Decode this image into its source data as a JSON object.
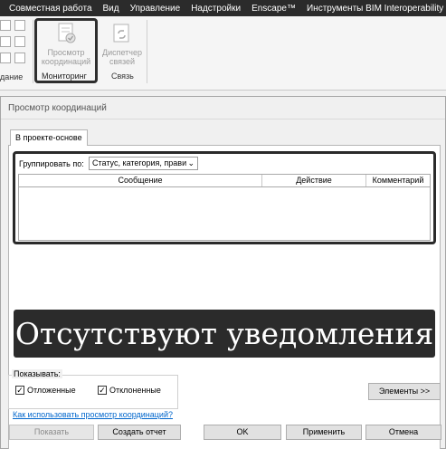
{
  "ribbon": {
    "menu": [
      "Совместная работа",
      "Вид",
      "Управление",
      "Надстройки",
      "Enscape™",
      "Инструменты BIM Interoperability"
    ],
    "left_panel_label": "дание",
    "buttons": {
      "coordination_review": [
        "Просмотр",
        "координаций"
      ],
      "link_manager": [
        "Диспетчер",
        "связей"
      ]
    },
    "panels": {
      "monitoring": "Мониторинг",
      "link": "Связь"
    }
  },
  "dialog": {
    "title": "Просмотр координаций",
    "tab": "В проекте-основе",
    "group_by_label": "Группировать по:",
    "group_by_value": "Статус, категория, прави",
    "columns": [
      "Сообщение",
      "Действие",
      "Комментарий"
    ],
    "banner": "Отсутствуют уведомления",
    "show_legend": "Показывать:",
    "checkboxes": [
      {
        "label": "Отложенные",
        "checked": true
      },
      {
        "label": "Отклоненные",
        "checked": true
      }
    ],
    "elements_button": "Элементы >>",
    "help_link": "Как использовать просмотр координаций?",
    "buttons": {
      "show": "Показать",
      "report": "Создать отчет",
      "ok": "OK",
      "apply": "Применить",
      "cancel": "Отмена"
    }
  }
}
